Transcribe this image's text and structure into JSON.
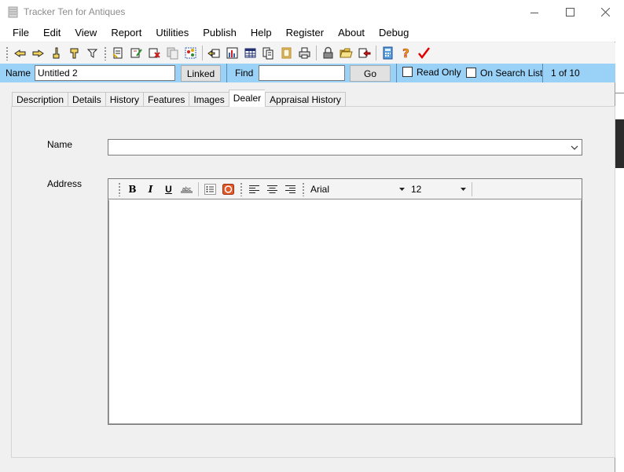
{
  "window": {
    "title": "Tracker Ten for Antiques",
    "controls": [
      "minimize-icon",
      "maximize-icon",
      "close-icon"
    ]
  },
  "menu": [
    "File",
    "Edit",
    "View",
    "Report",
    "Utilities",
    "Publish",
    "Help",
    "Register",
    "About",
    "Debug"
  ],
  "toolbar": {
    "icons": [
      "first-record-icon",
      "previous-record-icon",
      "next-record-icon",
      "last-record-icon",
      "filter-icon",
      "new-record-icon",
      "edit-record-icon",
      "delete-record-icon",
      "duplicate-record-icon",
      "sort-icon",
      "link-icon",
      "chart-icon",
      "table-view-icon",
      "pages-icon",
      "image-icon",
      "print-icon",
      "lock-icon",
      "open-folder-icon",
      "export-icon",
      "calculator-icon",
      "help-icon",
      "checkmark-icon"
    ]
  },
  "record_bar": {
    "name_label": "Name",
    "name_value": "Untitled 2",
    "linked_label": "Linked",
    "find_label": "Find",
    "find_value": "",
    "go_label": "Go",
    "read_only_label": "Read Only",
    "read_only_checked": false,
    "search_list_label": "On Search List",
    "search_list_checked": false,
    "position": "1 of 10"
  },
  "tabs": [
    {
      "label": "Description",
      "active": false
    },
    {
      "label": "Details",
      "active": false
    },
    {
      "label": "History",
      "active": false
    },
    {
      "label": "Features",
      "active": false
    },
    {
      "label": "Images",
      "active": false
    },
    {
      "label": "Dealer",
      "active": true
    },
    {
      "label": "Appraisal History",
      "active": false
    }
  ],
  "dealer": {
    "name_label": "Name",
    "name_value": "",
    "address_label": "Address",
    "address_value": "",
    "editor": {
      "bold": "B",
      "italic": "I",
      "underline": "U",
      "font": "Arial",
      "size": "12"
    }
  },
  "colors": {
    "record_bar": "#99d1f7",
    "panel": "#f0f0f0"
  }
}
